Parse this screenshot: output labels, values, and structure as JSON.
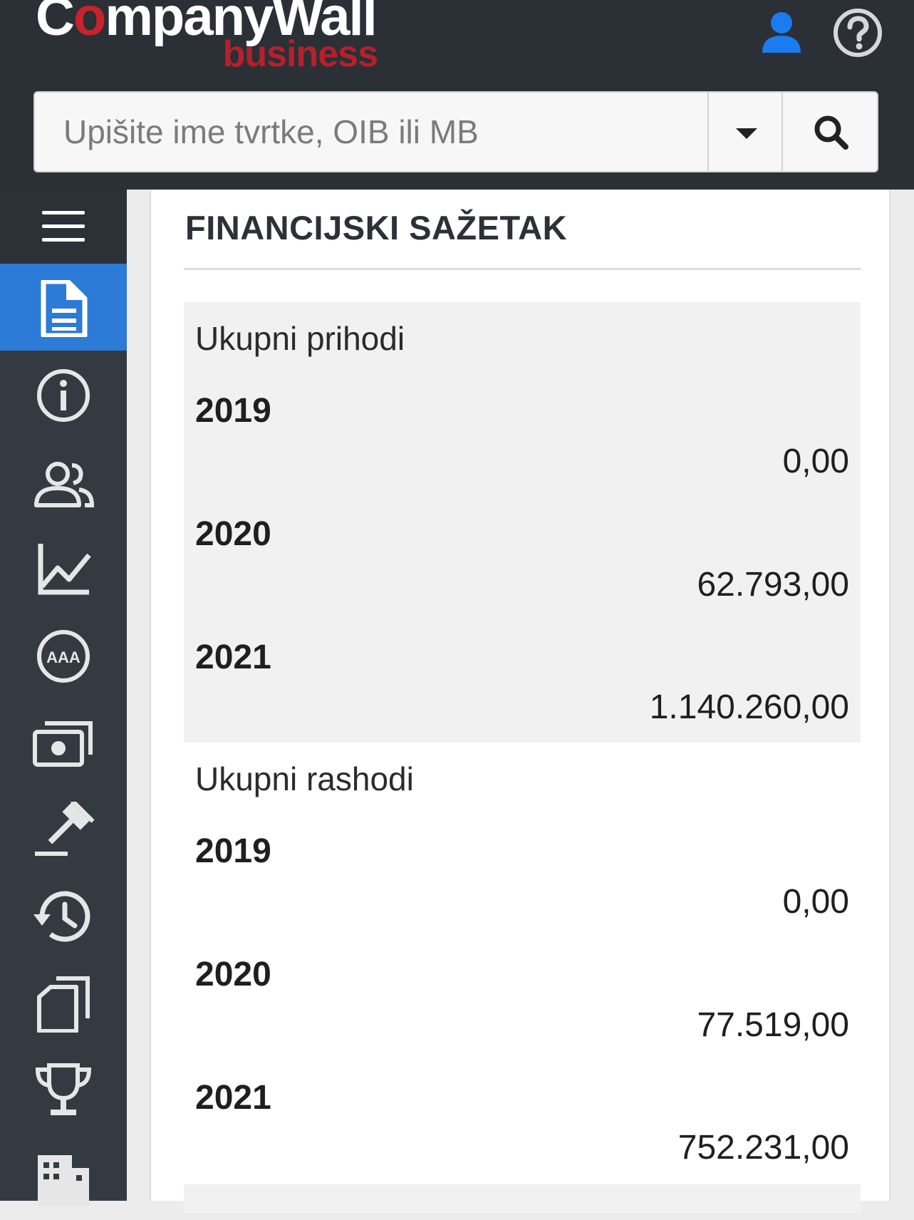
{
  "header": {
    "logo_main": "CompanyWall",
    "logo_sub": "business",
    "user_icon": "user-icon",
    "help_icon": "help-circle-icon"
  },
  "search": {
    "placeholder": "Upišite ime tvrtke, OIB ili MB",
    "value": "",
    "dropdown_icon": "caret-down-icon",
    "search_icon": "search-icon"
  },
  "sidebar": {
    "items": [
      {
        "icon": "hamburger-menu-icon"
      },
      {
        "icon": "document-icon",
        "active": true
      },
      {
        "icon": "info-icon"
      },
      {
        "icon": "people-icon"
      },
      {
        "icon": "line-chart-icon"
      },
      {
        "icon": "rating-aaa-icon"
      },
      {
        "icon": "money-icon"
      },
      {
        "icon": "gavel-icon"
      },
      {
        "icon": "history-icon"
      },
      {
        "icon": "copy-icon"
      },
      {
        "icon": "trophy-icon"
      },
      {
        "icon": "building-icon"
      }
    ]
  },
  "main": {
    "title": "FINANCIJSKI SAŽETAK",
    "sections": [
      {
        "label": "Ukupni prihodi",
        "rows": [
          {
            "year": "2019",
            "amount": "0,00"
          },
          {
            "year": "2020",
            "amount": "62.793,00"
          },
          {
            "year": "2021",
            "amount": "1.140.260,00"
          }
        ]
      },
      {
        "label": "Ukupni rashodi",
        "rows": [
          {
            "year": "2019",
            "amount": "0,00"
          },
          {
            "year": "2020",
            "amount": "77.519,00"
          },
          {
            "year": "2021",
            "amount": "752.231,00"
          }
        ]
      }
    ]
  },
  "colors": {
    "header_bg": "#2b2f36",
    "sidebar_bg": "#343a42",
    "active_blue": "#2c7bd6",
    "brand_red": "#c8232c",
    "user_icon_blue": "#1a7cf0"
  }
}
